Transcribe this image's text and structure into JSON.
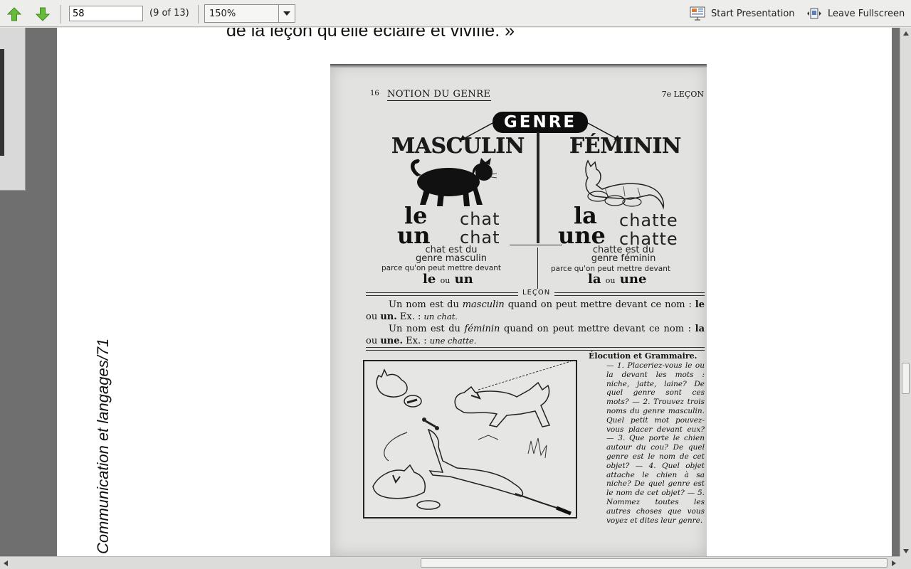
{
  "toolbar": {
    "page_number_value": "58",
    "page_count": "(9 of 13)",
    "zoom_value": "150%",
    "start_presentation_label": "Start Presentation",
    "leave_fullscreen_label": "Leave Fullscreen",
    "icons": {
      "prev": "arrow-up-icon",
      "next": "arrow-down-icon",
      "presentation": "presentation-icon",
      "fullscreen": "leave-fullscreen-icon",
      "zoom_dropdown": "chevron-down-icon"
    },
    "accent_color": "#4aa52e"
  },
  "document": {
    "top_text": "de la leçon qu'elle éclaire et vivifie. »",
    "side_text": "Communication et langages/71",
    "scan": {
      "page_number": "16",
      "section_title": "NOTION DU GENRE",
      "lesson": "7e LEÇON",
      "genre_label": "GENRE",
      "masculin": {
        "title": "MASCULIN",
        "article_1": "le",
        "noun_1": "chat",
        "article_2": "un",
        "noun_2": "chat",
        "line_1": "chat est du",
        "line_2": "genre masculin",
        "line_3": "parce qu'on peut mettre devant",
        "art_a": "le",
        "ou": "ou",
        "art_b": "un"
      },
      "feminin": {
        "title": "FÉMININ",
        "article_1": "la",
        "noun_1": "chatte",
        "article_2": "une",
        "noun_2": "chatte",
        "line_1": "chatte est du",
        "line_2": "genre féminin",
        "line_3": "parce qu'on peut mettre devant",
        "art_a": "la",
        "ou": "ou",
        "art_b": "une"
      },
      "lecon_label": "LEÇON",
      "rule_1": {
        "a": "Un nom est du ",
        "b": "masculin",
        "c": " quand on peut mettre devant ce nom :",
        "d": "le",
        "e": " ou ",
        "f": "un.",
        "g": " Ex. : ",
        "h": "un chat."
      },
      "rule_2": {
        "a": "Un nom est du ",
        "b": "féminin",
        "c": " quand on peut mettre devant ce nom :",
        "d": "la",
        "e": " ou ",
        "f": "une.",
        "g": " Ex. : ",
        "h": "une chatte."
      },
      "elocution_title": "Élocution et Grammaire.",
      "exercises": "— 1. Placeriez-vous le ou la devant les mots : niche, jatte, laine? De quel genre sont ces mots? — 2. Trouvez trois noms du genre masculin. Quel petit mot pouvez-vous placer devant eux? — 3. Que porte le chien autour du cou? De quel genre est le nom de cet objet? — 4. Quel objet attache le chien à sa niche? De quel genre est le nom de cet objet? — 5. Nommez toutes les autres choses que vous voyez et dites leur genre."
    }
  }
}
